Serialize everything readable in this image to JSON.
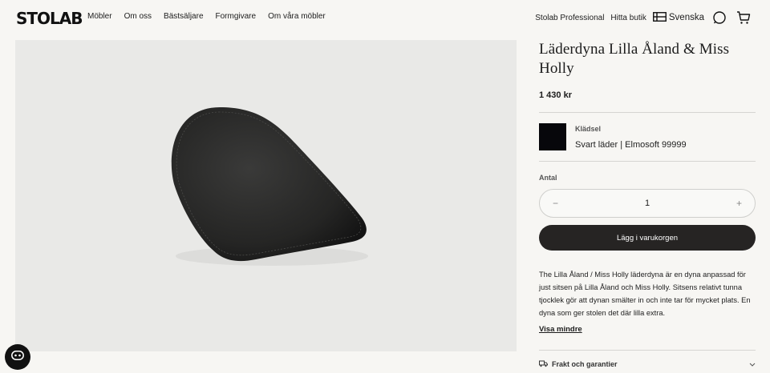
{
  "brand": {
    "logo_text": "STOLAB"
  },
  "nav": {
    "items": [
      "Möbler",
      "Om oss",
      "Bästsäljare",
      "Formgivare",
      "Om våra möbler"
    ]
  },
  "utility": {
    "professional": "Stolab Professional",
    "find_store": "Hitta butik",
    "language": "Svenska"
  },
  "product": {
    "title": "Läderdyna Lilla Åland & Miss Holly",
    "price": "1 430 kr",
    "upholstery_label": "Klädsel",
    "upholstery_value": "Svart läder | Elmosoft 99999",
    "swatch_color": "#07070b",
    "quantity_label": "Antal",
    "quantity": "1",
    "minus": "−",
    "plus": "+",
    "add_to_cart": "Lägg i varukorgen",
    "description": "The Lilla Åland / Miss Holly läderdyna är en dyna anpassad för just sitsen på Lilla Åland och Miss Holly. Sitsens relativt tunna tjocklek gör att dynan smälter in och inte tar för mycket plats. En dyna som ger stolen det där lilla extra.",
    "show_less": "Visa mindre",
    "accordion": [
      {
        "label": "Frakt och garantier",
        "icon": "truck-icon"
      }
    ]
  },
  "icons": {
    "search": "search-icon",
    "cart": "cart-icon",
    "flag": "flag-icon",
    "chat": "chat-icon"
  }
}
